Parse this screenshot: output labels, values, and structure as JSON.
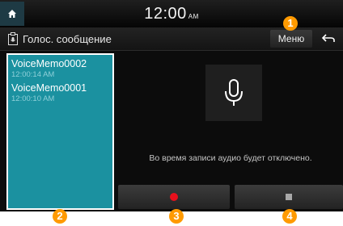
{
  "status_bar": {
    "time": "12:00",
    "ampm": "AM"
  },
  "title_bar": {
    "title": "Голос. сообщение",
    "menu_label": "Меню"
  },
  "memos": [
    {
      "name": "VoiceMemo0002",
      "time": "12:00:14 AM"
    },
    {
      "name": "VoiceMemo0001",
      "time": "12:00:10 AM"
    }
  ],
  "main": {
    "notice": "Во время записи аудио будет отключено."
  },
  "callouts": [
    "1",
    "2",
    "3",
    "4"
  ],
  "colors": {
    "list_bg": "#1b91a0",
    "record_dot": "#e8101c",
    "badge": "#ff9a00"
  }
}
